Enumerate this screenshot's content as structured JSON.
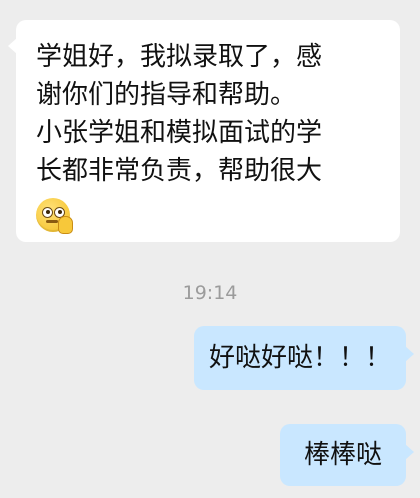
{
  "chat": {
    "incoming": {
      "lines": [
        "学姐好，我拟录取了，感",
        "谢你们的指导和帮助。",
        "小张学姐和模拟面试的学",
        "长都非常负责，帮助很大"
      ],
      "emoji": "thinking-face-icon"
    },
    "timestamp": "19:14",
    "outgoing": [
      {
        "text": "好哒好哒！！！"
      },
      {
        "text": "棒棒哒"
      }
    ]
  }
}
